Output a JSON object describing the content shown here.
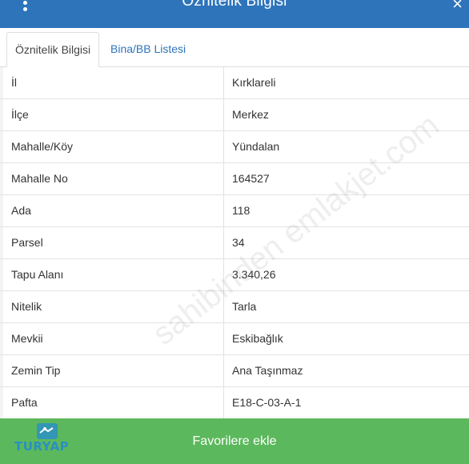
{
  "header": {
    "title": "Öznitelik Bilgisi",
    "menu_icon": "vertical-dots-icon",
    "close_icon": "close-icon",
    "close_glyph": "×"
  },
  "tabs": [
    {
      "label": "Öznitelik Bilgisi",
      "active": true
    },
    {
      "label": "Bina/BB Listesi",
      "active": false
    }
  ],
  "rows": [
    {
      "key": "İl",
      "value": "Kırklareli"
    },
    {
      "key": "İlçe",
      "value": "Merkez"
    },
    {
      "key": "Mahalle/Köy",
      "value": "Yündalan"
    },
    {
      "key": "Mahalle No",
      "value": "164527"
    },
    {
      "key": "Ada",
      "value": "118"
    },
    {
      "key": "Parsel",
      "value": "34"
    },
    {
      "key": "Tapu Alanı",
      "value": "3.340,26"
    },
    {
      "key": "Nitelik",
      "value": "Tarla"
    },
    {
      "key": "Mevkii",
      "value": "Eskibağlık"
    },
    {
      "key": "Zemin Tip",
      "value": "Ana Taşınmaz"
    },
    {
      "key": "Pafta",
      "value": "E18-C-03-A-1"
    }
  ],
  "watermark": "sahibinden emlakjet.com",
  "footer": {
    "button_label": "Favorilere ekle",
    "logo_text": "TURYAP"
  },
  "colors": {
    "header": "#2e74bb",
    "tab_link": "#2e74bb",
    "button": "#5cb85c",
    "logo": "#2a8fc3"
  }
}
